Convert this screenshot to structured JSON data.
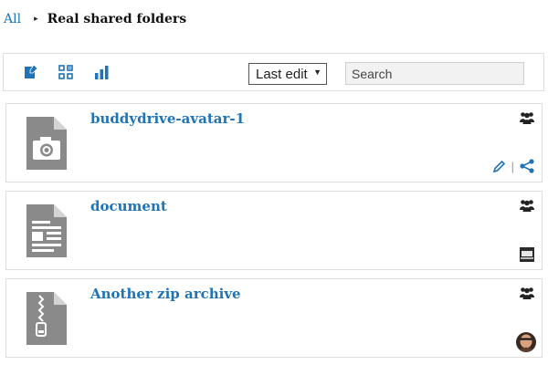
{
  "breadcrumb": {
    "root": "All",
    "separator": "▸",
    "current": "Real shared folders"
  },
  "toolbar": {
    "icons": [
      "new-item-icon",
      "bulk-select-icon",
      "stats-icon"
    ],
    "sort_value": "Last edit",
    "search_placeholder": "Search"
  },
  "items": [
    {
      "title": "buddydrive-avatar-1",
      "type_icon": "image-file-icon",
      "privacy_icon": "group-icon",
      "actions": [
        "edit-icon",
        "share-icon"
      ]
    },
    {
      "title": "document",
      "type_icon": "document-file-icon",
      "privacy_icon": "group-icon",
      "owner_icon": "laptop-avatar-icon"
    },
    {
      "title": "Another zip archive",
      "type_icon": "zip-file-icon",
      "privacy_icon": "group-icon",
      "owner_icon": "user-avatar-icon"
    }
  ],
  "colors": {
    "link": "#1f73b7",
    "file_icon": "#8a8a8a",
    "border": "#dedede"
  }
}
